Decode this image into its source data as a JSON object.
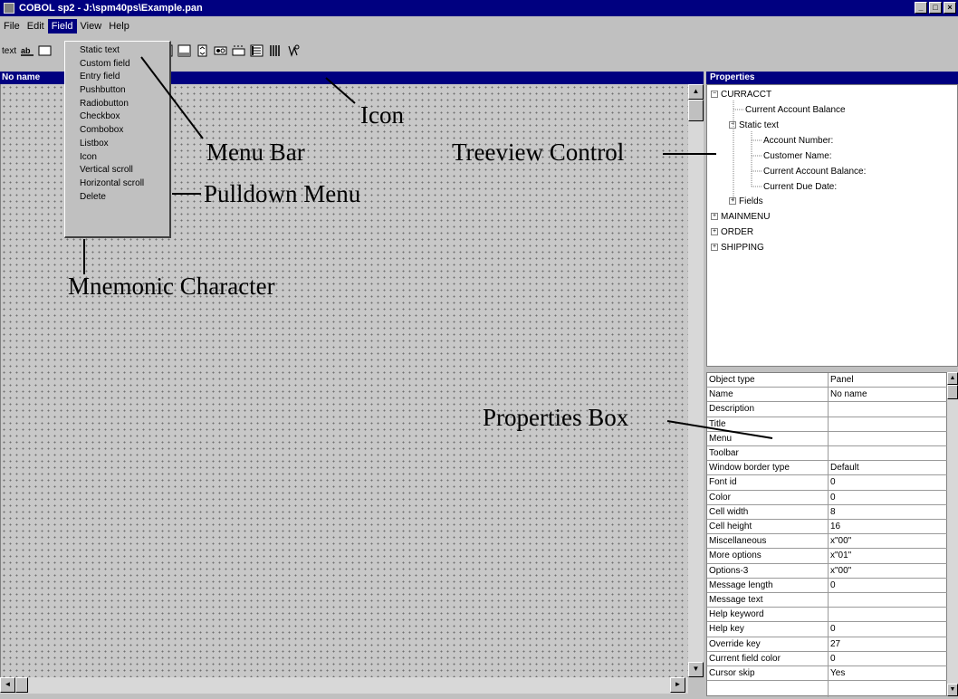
{
  "window": {
    "title": "COBOL sp2 - J:\\spm40ps\\Example.pan"
  },
  "menubar": {
    "items": [
      "File",
      "Edit",
      "Field",
      "View",
      "Help"
    ]
  },
  "toolbar": {
    "text_label": "text"
  },
  "canvas": {
    "title": "No name"
  },
  "pulldown": {
    "items": [
      "Static text",
      "Custom field",
      "Entry field",
      "Pushbutton",
      "Radiobutton",
      "Checkbox",
      "Combobox",
      "Listbox",
      "Icon",
      "Vertical scroll",
      "Horizontal scroll",
      "Delete"
    ]
  },
  "annotations": {
    "icon": "Icon",
    "menu_bar": "Menu Bar",
    "treeview": "Treeview Control",
    "pulldown": "Pulldown Menu",
    "mnemonic": "Mnemonic Character",
    "properties_box": "Properties Box"
  },
  "properties": {
    "title": "Properties",
    "tree": [
      {
        "label": "CURRACCT",
        "expander": "−"
      },
      {
        "label": "Current Account Balance"
      },
      {
        "label": "Static text",
        "expander": "−"
      },
      {
        "label": "Account Number:"
      },
      {
        "label": "Customer Name:"
      },
      {
        "label": "Current Account Balance:"
      },
      {
        "label": "Current Due Date:"
      },
      {
        "label": "Fields",
        "expander": "+"
      },
      {
        "label": "MAINMENU",
        "expander": "+"
      },
      {
        "label": "ORDER",
        "expander": "+"
      },
      {
        "label": "SHIPPING",
        "expander": "+"
      }
    ],
    "rows": [
      {
        "name": "Object type",
        "value": "Panel"
      },
      {
        "name": "Name",
        "value": "No name"
      },
      {
        "name": "Description",
        "value": ""
      },
      {
        "name": "Title",
        "value": ""
      },
      {
        "name": "Menu",
        "value": ""
      },
      {
        "name": "Toolbar",
        "value": ""
      },
      {
        "name": "Window border type",
        "value": "Default"
      },
      {
        "name": "Font id",
        "value": "0"
      },
      {
        "name": "Color",
        "value": "0"
      },
      {
        "name": "Cell width",
        "value": "8"
      },
      {
        "name": "Cell height",
        "value": "16"
      },
      {
        "name": "Miscellaneous",
        "value": "x\"00\""
      },
      {
        "name": "More options",
        "value": "x\"01\""
      },
      {
        "name": "Options-3",
        "value": "x\"00\""
      },
      {
        "name": "Message length",
        "value": "0"
      },
      {
        "name": "Message text",
        "value": ""
      },
      {
        "name": "Help keyword",
        "value": ""
      },
      {
        "name": "Help key",
        "value": "0"
      },
      {
        "name": "Override key",
        "value": "27"
      },
      {
        "name": "Current field color",
        "value": "0"
      },
      {
        "name": "Cursor skip",
        "value": "Yes"
      }
    ]
  }
}
